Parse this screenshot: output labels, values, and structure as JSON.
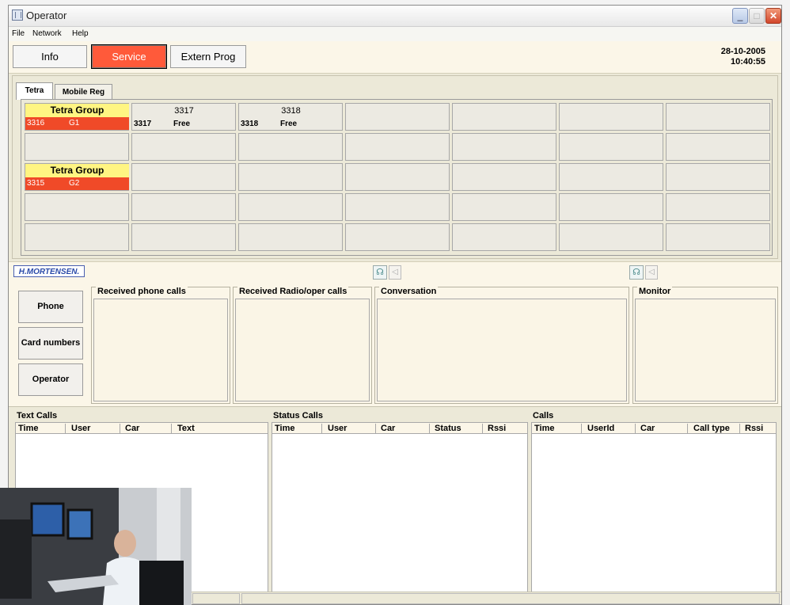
{
  "window": {
    "title": "Operator",
    "minimize": "_",
    "maximize": "□",
    "close": "✕"
  },
  "menu": [
    "File",
    "Network",
    "Help"
  ],
  "toolbar": {
    "info": "Info",
    "service": "Service",
    "extern": "Extern Prog",
    "date": "28-10-2005",
    "time": "10:40:55"
  },
  "tabs": [
    "Tetra",
    "Mobile Reg"
  ],
  "groups": [
    {
      "title": "Tetra Group",
      "number": "3316",
      "name": "G1"
    },
    {
      "title": "Tetra Group",
      "number": "3315",
      "name": "G2"
    }
  ],
  "subscribers": [
    {
      "top": "3317",
      "number": "3317",
      "status": "Free"
    },
    {
      "top": "3318",
      "number": "3318",
      "status": "Free"
    }
  ],
  "logo": "H.MORTENSEN.",
  "icons": {
    "headset": "headset-icon",
    "speaker": "speaker-icon"
  },
  "side_buttons": [
    "Phone",
    "Card numbers",
    "Operator"
  ],
  "panels": {
    "received_phone": "Received phone calls",
    "received_radio": "Received Radio/oper calls",
    "conversation": "Conversation",
    "monitor": "Monitor"
  },
  "text_calls": {
    "title": "Text Calls",
    "columns": [
      "Time",
      "User",
      "Car",
      "Text"
    ]
  },
  "status_calls": {
    "title": "Status Calls",
    "columns": [
      "Time",
      "User",
      "Car",
      "Status",
      "Rssi"
    ]
  },
  "calls": {
    "title": "Calls",
    "columns": [
      "Time",
      "UserId",
      "Car",
      "Call type",
      "Rssi"
    ]
  },
  "colors": {
    "group_header": "#fff582",
    "group_sub": "#f04a28",
    "service_button": "#ff5a3a",
    "panel_bg": "#fbf6e8"
  }
}
